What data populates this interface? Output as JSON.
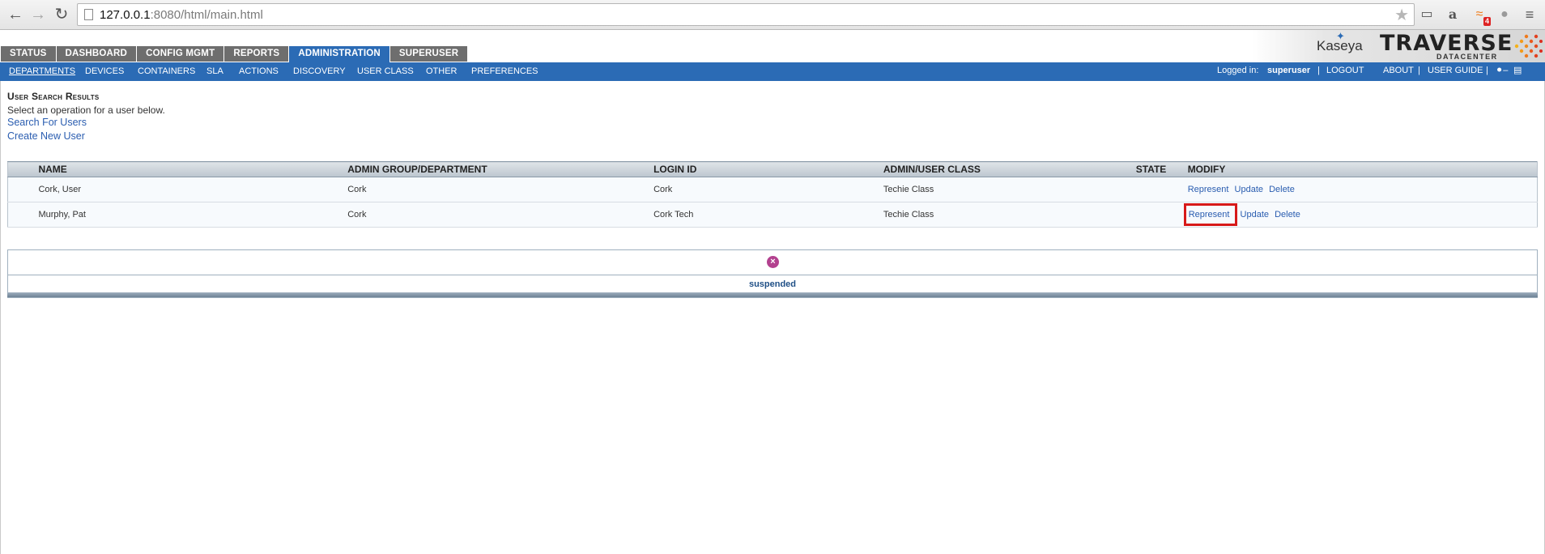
{
  "browser": {
    "url_host": "127.0.0.1",
    "url_path": ":8080/html/main.html",
    "rss_badge": "4"
  },
  "main_tabs": [
    {
      "label": "STATUS"
    },
    {
      "label": "DASHBOARD"
    },
    {
      "label": "CONFIG MGMT"
    },
    {
      "label": "REPORTS"
    },
    {
      "label": "ADMINISTRATION",
      "active": true
    },
    {
      "label": "SUPERUSER"
    }
  ],
  "brand": {
    "kaseya": "Kaseya",
    "traverse": "TRAVERSE",
    "datacenter": "DATACENTER"
  },
  "sub_nav": {
    "items": [
      {
        "label": "DEPARTMENTS",
        "active": true
      },
      {
        "label": "DEVICES"
      },
      {
        "label": "CONTAINERS"
      },
      {
        "label": "SLA"
      },
      {
        "label": "ACTIONS"
      },
      {
        "label": "DISCOVERY"
      },
      {
        "label": "USER CLASS"
      },
      {
        "label": "OTHER"
      },
      {
        "label": "PREFERENCES"
      }
    ],
    "logged_in_label": "Logged in:",
    "username": "superuser",
    "logout": "LOGOUT",
    "about": "ABOUT",
    "user_guide": "USER GUIDE",
    "separator": "|"
  },
  "page": {
    "title": "User Search Results",
    "instructions": "Select an operation for a user below.",
    "search_link": "Search For Users",
    "create_link": "Create New User"
  },
  "table": {
    "headers": {
      "name": "NAME",
      "group": "ADMIN GROUP/DEPARTMENT",
      "login": "LOGIN ID",
      "class": "ADMIN/USER CLASS",
      "state": "STATE",
      "modify": "MODIFY"
    },
    "rows": [
      {
        "name": "Cork, User",
        "group": "Cork",
        "login": "Cork",
        "class": "Techie Class",
        "state": ""
      },
      {
        "name": "Murphy, Pat",
        "group": "Cork",
        "login": "Cork Tech",
        "class": "Techie Class",
        "state": ""
      }
    ],
    "actions": {
      "represent": "Represent",
      "update": "Update",
      "delete": "Delete"
    }
  },
  "legend": {
    "icon": "suspended-icon",
    "label": "suspended",
    "icon_color": "#b3418f"
  },
  "colors": {
    "nav_blue": "#2b6bb5",
    "tab_gray": "#6e6e6e",
    "link_blue": "#2a5db0",
    "highlight_red": "#d71919"
  }
}
